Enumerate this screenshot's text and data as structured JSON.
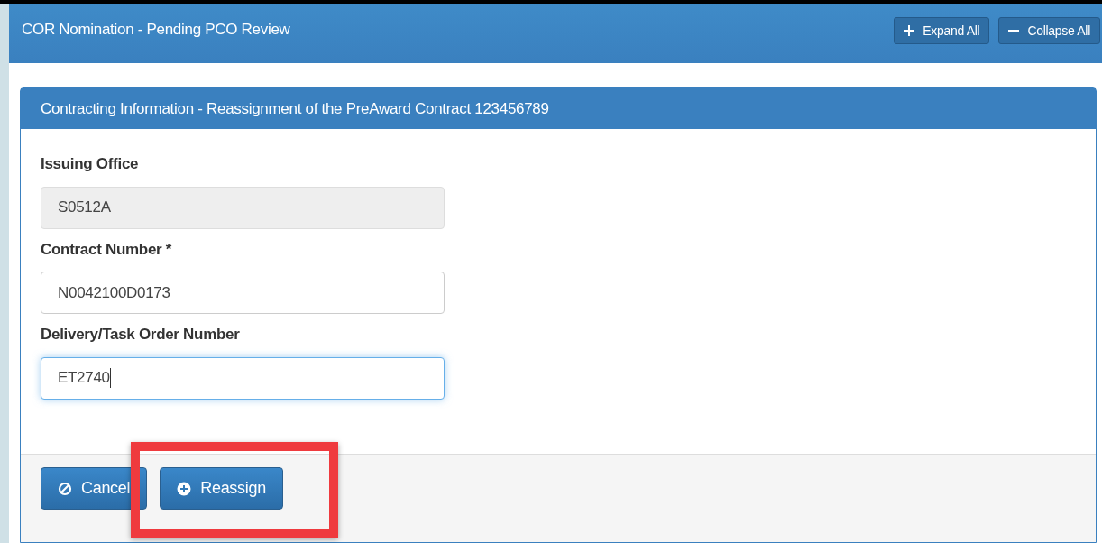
{
  "page_header": {
    "title": "COR Nomination - Pending PCO Review",
    "buttons": [
      {
        "kind": "expand",
        "label": "Expand All"
      },
      {
        "kind": "collapse",
        "label": "Collapse All"
      }
    ]
  },
  "panel": {
    "title": "Contracting Information - Reassignment of the PreAward Contract 123456789",
    "fields": [
      {
        "label": "Issuing Office",
        "value": "S0512A",
        "disabled": true,
        "focused": false
      },
      {
        "label": "Contract Number *",
        "value": "N0042100D0173",
        "disabled": false,
        "focused": false
      },
      {
        "label": "Delivery/Task Order Number",
        "value": "ET2740",
        "disabled": false,
        "focused": true
      }
    ],
    "actions": [
      {
        "kind": "cancel",
        "label": "Cancel",
        "highlighted": false
      },
      {
        "kind": "reassign",
        "label": "Reassign",
        "highlighted": true
      }
    ]
  }
}
